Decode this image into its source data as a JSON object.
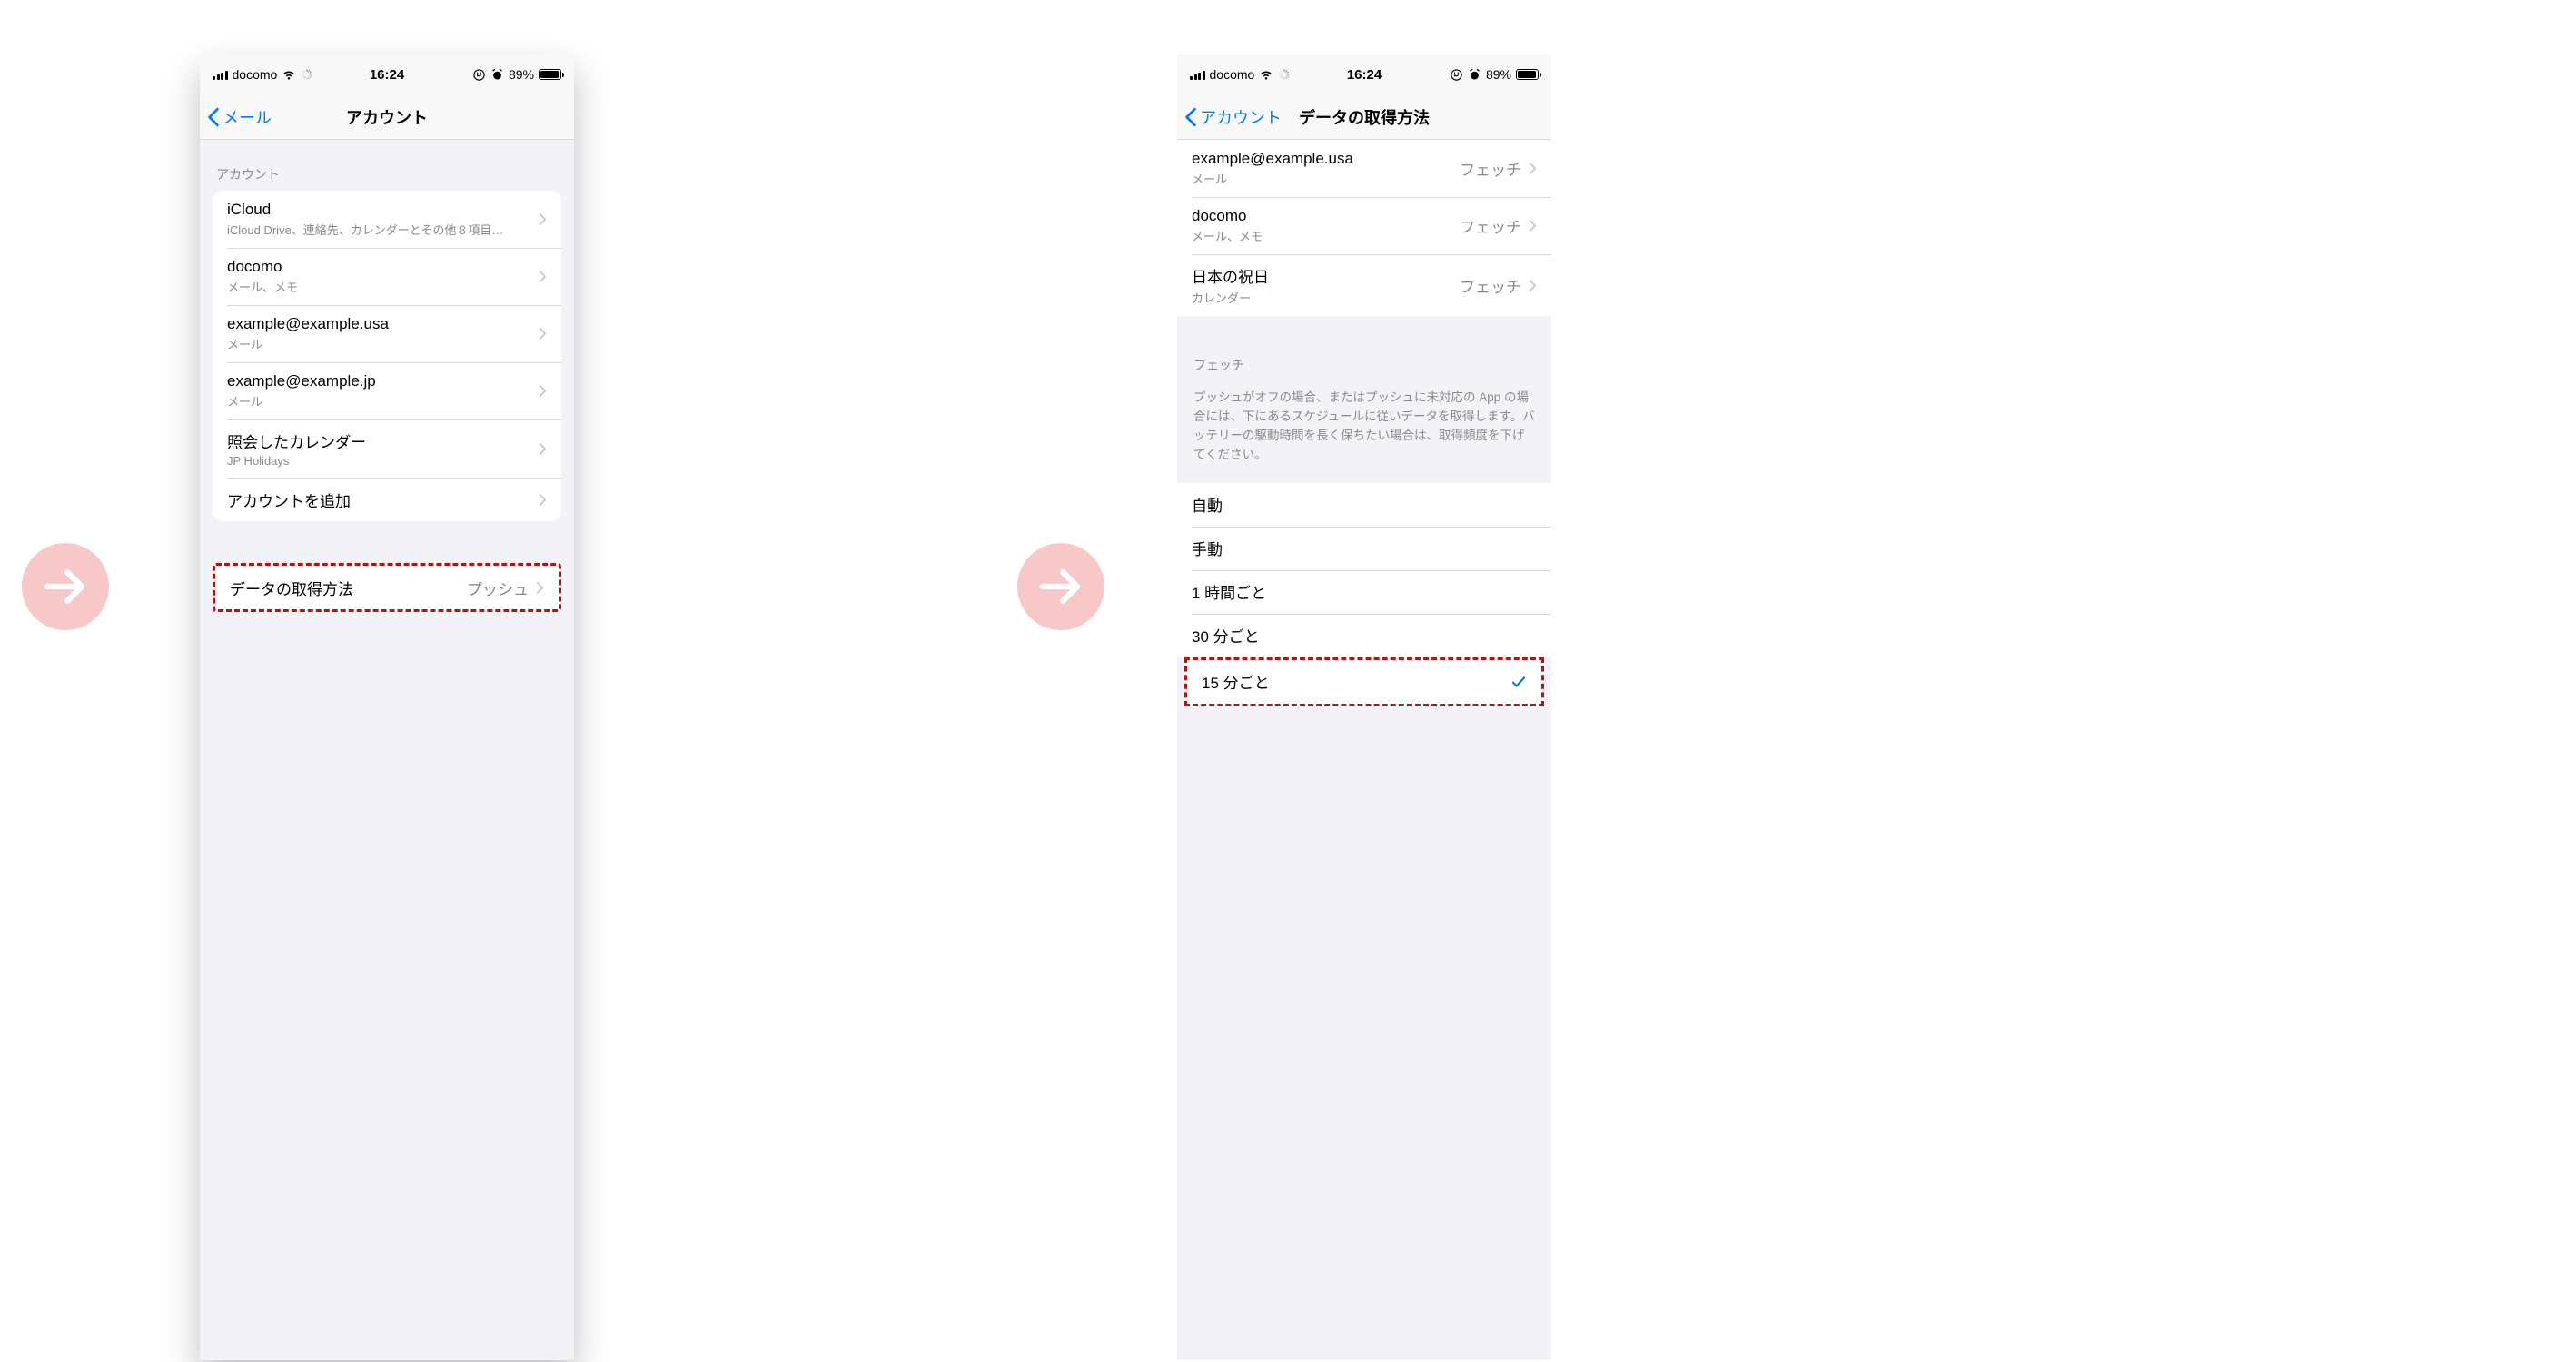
{
  "status": {
    "carrier": "docomo",
    "time": "16:24",
    "battery_text": "89%"
  },
  "screen1": {
    "nav": {
      "back": "メール",
      "title": "アカウント"
    },
    "section_label": "アカウント",
    "accounts": [
      {
        "title": "iCloud",
        "sub": "iCloud Drive、連絡先、カレンダーとその他８項目…"
      },
      {
        "title": "docomo",
        "sub": "メール、メモ"
      },
      {
        "title": "example@example.usa",
        "sub": "メール"
      },
      {
        "title": "example@example.jp",
        "sub": "メール"
      },
      {
        "title": "照会したカレンダー",
        "sub": "JP Holidays"
      }
    ],
    "add_account": "アカウントを追加",
    "fetch_row": {
      "title": "データの取得方法",
      "value": "プッシュ"
    }
  },
  "screen2": {
    "nav": {
      "back": "アカウント",
      "title": "データの取得方法"
    },
    "accounts": [
      {
        "title": "example@example.usa",
        "sub": "メール",
        "value": "フェッチ"
      },
      {
        "title": "docomo",
        "sub": "メール、メモ",
        "value": "フェッチ"
      },
      {
        "title": "日本の祝日",
        "sub": "カレンダー",
        "value": "フェッチ"
      }
    ],
    "fetch_header": "フェッチ",
    "fetch_desc": "プッシュがオフの場合、またはプッシュに未対応の App の場合には、下にあるスケジュールに従いデータを取得します。バッテリーの駆動時間を長く保ちたい場合は、取得頻度を下げてください。",
    "schedule": [
      {
        "label": "自動",
        "checked": false
      },
      {
        "label": "手動",
        "checked": false
      },
      {
        "label": "1 時間ごと",
        "checked": false
      },
      {
        "label": "30 分ごと",
        "checked": false
      },
      {
        "label": "15 分ごと",
        "checked": true
      }
    ]
  }
}
